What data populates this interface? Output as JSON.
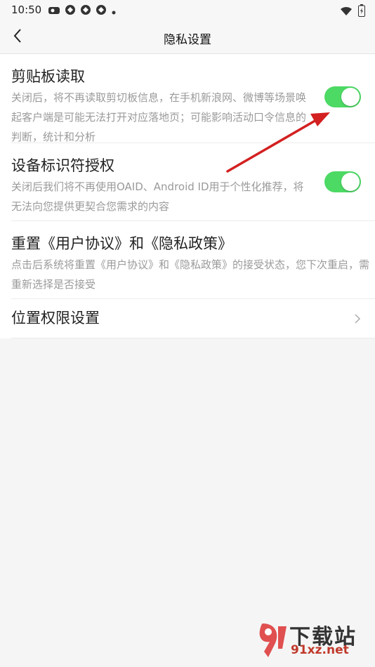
{
  "status_bar": {
    "time": "10:50",
    "left_icons": [
      "weibo-icon",
      "app-icon",
      "app-icon",
      "app-icon",
      "dot-icon"
    ],
    "right_icons": [
      "wifi-icon",
      "battery-icon"
    ]
  },
  "header": {
    "title": "隐私设置"
  },
  "settings": [
    {
      "title": "剪贴板读取",
      "desc": "关闭后，将不再读取剪切板信息，在手机新浪网、微博等场景唤起客户端是可能无法打开对应落地页；可能影响活动口令信息的判断，统计和分析",
      "toggle": true
    },
    {
      "title": "设备标识符授权",
      "desc": "关闭后我们将不再使用OAID、Android ID用于个性化推荐，将无法向您提供更契合您需求的内容",
      "toggle": true
    },
    {
      "title": "重置《用户协议》和《隐私政策》",
      "desc": "点击后系统将重置《用户协议》和《隐私政策》的接受状态，您下次重启，需重新选择是否接受"
    },
    {
      "title": "位置权限设置"
    }
  ],
  "colors": {
    "toggle_on": "#4cd964",
    "annotation_arrow": "#d32020"
  },
  "watermark": {
    "name": "下载站",
    "url": "91xz.net"
  }
}
